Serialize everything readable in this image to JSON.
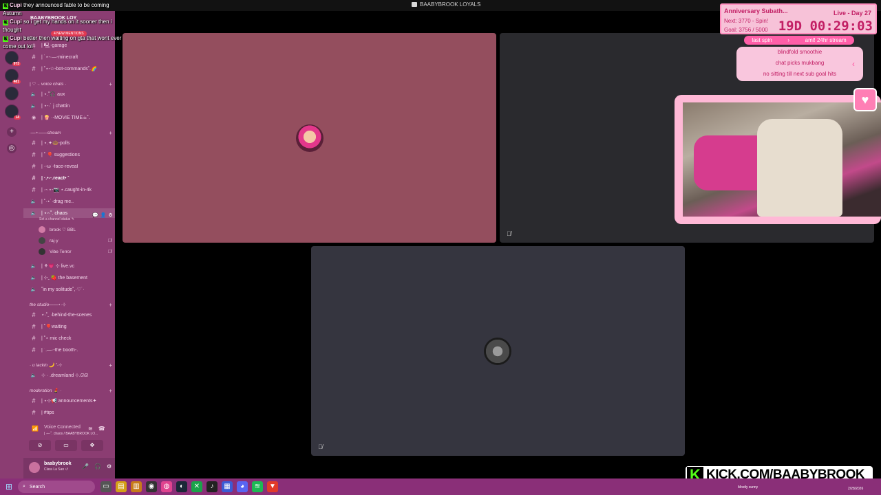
{
  "window": {
    "title": "BAABYBROOK LOYALS"
  },
  "chat": [
    {
      "user": "Cupi",
      "message": "they announced fable to be coming"
    },
    {
      "user": "",
      "message": "Autumn"
    },
    {
      "user": "Cupi",
      "message": "so i get my hands on it sooner then i"
    },
    {
      "user": "",
      "message": "thought"
    },
    {
      "user": "Cupi",
      "message": "better then waiting on gta that wont ever"
    },
    {
      "user": "",
      "message": "come out lol"
    }
  ],
  "rail": {
    "badges": [
      "973",
      "481",
      "14"
    ],
    "add_icon": "plus-icon",
    "explore_icon": "compass-icon"
  },
  "sidebar": {
    "server_name": "BAABYBROOK LOY",
    "new_mentions": "4 NEW MENTIONS",
    "channels_top": [
      {
        "label": "| 🖳-garage",
        "type": "text"
      },
      {
        "label": "| ˙⋆-·—-minecraft",
        "type": "text"
      },
      {
        "label": "| ˚⋆-☆-bot-commands˚.🌈",
        "type": "text"
      }
    ],
    "cat_voice": "| ♡ ·. voice chats ·",
    "channels_voice": [
      {
        "label": "| ⋆.˚🎧 aux",
        "type": "voice"
      },
      {
        "label": "| ⋆-·˙ j chattin",
        "type": "voice"
      },
      {
        "label": "| 🍿 ·-MOVIE TIME☕˚.",
        "type": "voice"
      }
    ],
    "cat_stream": "·—⋆——stream",
    "channels_stream": [
      {
        "label": "| ⋆.✦🍩-polls",
        "type": "text"
      },
      {
        "label": "| ˚ 🎈 suggestions",
        "type": "text"
      },
      {
        "label": "| ·-ω˙-face-reveal",
        "type": "text"
      },
      {
        "label": "| ·.•-·.react• ˚",
        "type": "text"
      },
      {
        "label": "| ·-·⋆-📷 ⋆.caught-in-4k",
        "type": "text"
      },
      {
        "label": "| ˚·⋆˙·drag me..",
        "type": "voice"
      },
      {
        "label": "| ⋆ᵕ·˚. chaos",
        "type": "voice"
      }
    ],
    "chaos_status": "Set a channel status ✎",
    "members": [
      {
        "name": "brook ♡ BBL"
      },
      {
        "name": "raj·y"
      },
      {
        "name": "Vibe Terror"
      }
    ],
    "channels_more": [
      {
        "label": "| ⚘💗 ⊹ live.vc",
        "type": "voice"
      },
      {
        "label": "| ⊹ˍ 🍓 the basement",
        "type": "voice"
      },
      {
        "label": "˚in my solitude˚,·♡˙·",
        "type": "voice"
      }
    ],
    "cat_studio": "the studio——⋆·⊹",
    "channels_studio": [
      {
        "label": "⋆·˚ˍ ·behind-the-scenes",
        "type": "text"
      },
      {
        "label": "| ˚🎈waiting",
        "type": "text"
      },
      {
        "label": "| ˚⋆ mic check",
        "type": "text"
      },
      {
        "label": "| ˙.—·-the booth-.",
        "type": "text"
      }
    ],
    "cat_lackin": "· u lackin 🌙 ˚·⊹",
    "channels_lackin": [
      {
        "label": "⊹ · .dreamland ⊹.ᘏᘏ",
        "type": "voice"
      }
    ],
    "cat_moderation": "moderation 💄 ·",
    "channels_mod": [
      {
        "label": "| ⋆⊹📢 announcements✦",
        "type": "text"
      },
      {
        "label": "| #tips",
        "type": "text"
      }
    ]
  },
  "voice": {
    "status": "Voice Connected",
    "channel": "| ⋆ᵕ·˚. chaos / BAABYBROOK LO..."
  },
  "user": {
    "name": "baabybrook",
    "status": "Clara La San ↺"
  },
  "overlay": {
    "title": "Anniversary Subath...",
    "live_day": "Live - Day 27",
    "next": "Next: 3770 - Spin!",
    "goal": "Goal: 3756 / 5000",
    "timer": "19D 00:29:03",
    "pill_left": "last spin",
    "pill_right": "aml! 24hr stream",
    "goals_list": [
      "blindfold smoothie",
      "chat picks mukbang",
      "no sitting till next sub goal hits"
    ]
  },
  "kick": {
    "url": "KICK.COM/BAABYBROOK",
    "logo": "K"
  },
  "taskbar": {
    "search_placeholder": "Search",
    "weather": "Mostly sunny",
    "date": "2/28/2026"
  },
  "colors": {
    "sidebar": "#8b3d72",
    "accent_pink": "#ff5fa8",
    "kick_green": "#53fc18"
  }
}
